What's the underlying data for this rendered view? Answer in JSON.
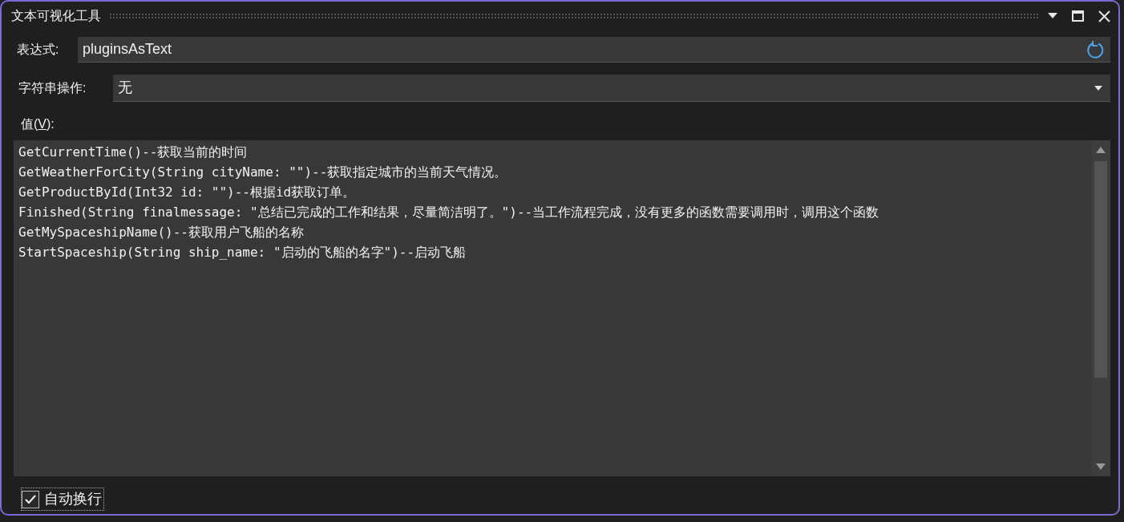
{
  "window": {
    "title": "文本可视化工具"
  },
  "expression": {
    "label": "表达式:",
    "value": "pluginsAsText"
  },
  "string_operation": {
    "label": "字符串操作:",
    "value": "无"
  },
  "value_section": {
    "label": {
      "before": "值(",
      "access_key": "V",
      "after": "):"
    },
    "lines": [
      "GetCurrentTime()--获取当前的时间",
      "GetWeatherForCity(String cityName: \"\")--获取指定城市的当前天气情况。",
      "GetProductById(Int32 id: \"\")--根据id获取订单。",
      "Finished(String finalmessage: \"总结已完成的工作和结果，尽量简洁明了。\")--当工作流程完成，没有更多的函数需要调用时，调用这个函数",
      "GetMySpaceshipName()--获取用户飞船的名称",
      "StartSpaceship(String ship_name: \"启动的飞船的名字\")--启动飞船"
    ]
  },
  "word_wrap": {
    "label": "自动换行",
    "checked": true
  }
}
